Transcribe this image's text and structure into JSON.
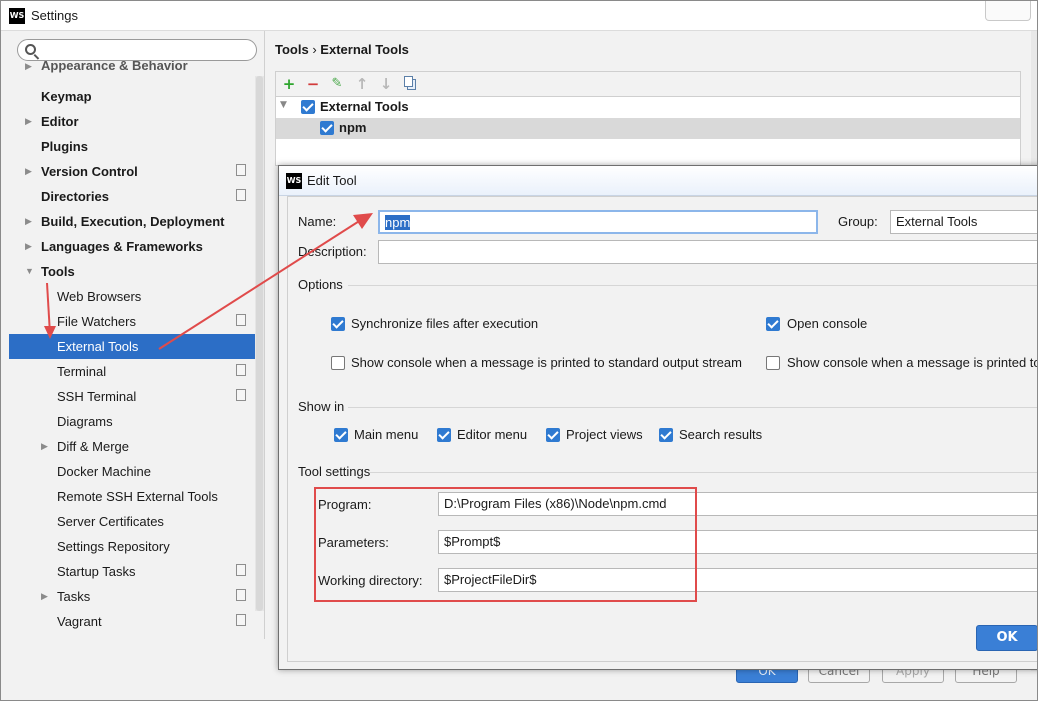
{
  "window": {
    "title": "Settings",
    "app_badge": "WS"
  },
  "search": {
    "placeholder": ""
  },
  "sidebar": {
    "items": [
      {
        "label": "Appearance & Behavior"
      },
      {
        "label": "Keymap"
      },
      {
        "label": "Editor"
      },
      {
        "label": "Plugins"
      },
      {
        "label": "Version Control"
      },
      {
        "label": "Directories"
      },
      {
        "label": "Build, Execution, Deployment"
      },
      {
        "label": "Languages & Frameworks"
      },
      {
        "label": "Tools"
      },
      {
        "label": "Web Browsers"
      },
      {
        "label": "File Watchers"
      },
      {
        "label": "External Tools"
      },
      {
        "label": "Terminal"
      },
      {
        "label": "SSH Terminal"
      },
      {
        "label": "Diagrams"
      },
      {
        "label": "Diff & Merge"
      },
      {
        "label": "Docker Machine"
      },
      {
        "label": "Remote SSH External Tools"
      },
      {
        "label": "Server Certificates"
      },
      {
        "label": "Settings Repository"
      },
      {
        "label": "Startup Tasks"
      },
      {
        "label": "Tasks"
      },
      {
        "label": "Vagrant"
      }
    ]
  },
  "breadcrumb": {
    "root": "Tools",
    "sep": "›",
    "current": "External Tools"
  },
  "tree": {
    "group": "External Tools",
    "child": "npm"
  },
  "bg_buttons": {
    "ok": "OK",
    "cancel": "Cancel",
    "apply": "Apply",
    "help": "Help"
  },
  "dialog": {
    "title": "Edit Tool",
    "badge": "WS",
    "name_label": "Name:",
    "name_value": "npm",
    "group_label": "Group:",
    "group_value": "External Tools",
    "description_label": "Description:",
    "description_value": "",
    "options_heading": "Options",
    "opt_sync": "Synchronize files after execution",
    "opt_open_console": "Open console",
    "opt_show_stdout": "Show console when a message is printed to standard output stream",
    "opt_show_stderr": "Show console when a message is printed to",
    "showin_heading": "Show in",
    "show_main_menu": "Main menu",
    "show_editor_menu": "Editor menu",
    "show_project_views": "Project views",
    "show_search_results": "Search results",
    "toolsettings_heading": "Tool settings",
    "program_label": "Program:",
    "program_value": "D:\\Program Files (x86)\\Node\\npm.cmd",
    "parameters_label": "Parameters:",
    "parameters_value": "$Prompt$",
    "workdir_label": "Working directory:",
    "workdir_value": "$ProjectFileDir$",
    "ok_label": "OK"
  },
  "colors": {
    "accent": "#2c6ec6",
    "annotation": "#e04b4b",
    "checkbox": "#2f7ad1"
  }
}
